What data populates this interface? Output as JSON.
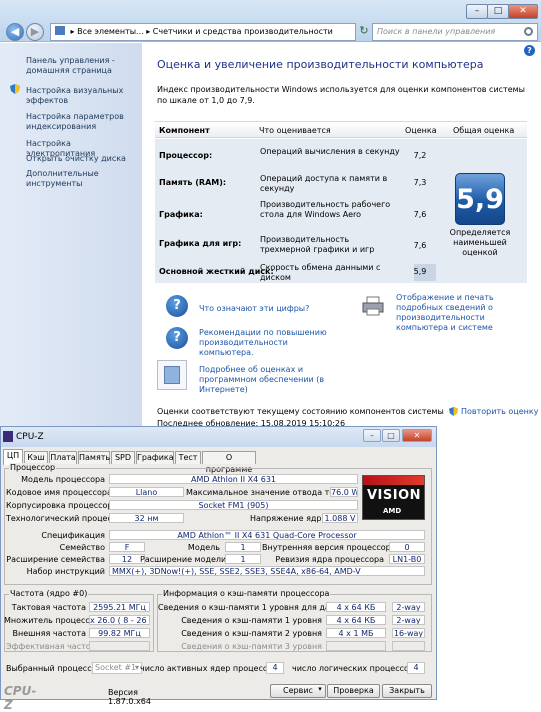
{
  "control_panel": {
    "breadcrumb": [
      "Все элементы...",
      "Счетчики и средства производительности"
    ],
    "search_placeholder": "Поиск в панели управления",
    "sidebar": {
      "items": [
        {
          "label": "Панель управления -\nдомашняя страница",
          "icon": ""
        },
        {
          "label": "Настройка визуальных\nэффектов",
          "icon": "shield-icon"
        },
        {
          "label": "Настройка параметров\nиндексирования",
          "icon": ""
        },
        {
          "label": "Настройка электропитания",
          "icon": ""
        },
        {
          "label": "Открыть очистку диска",
          "icon": ""
        },
        {
          "label": "Дополнительные\nинструменты",
          "icon": ""
        }
      ]
    },
    "title": "Оценка и увеличение производительности компьютера",
    "description": "Индекс производительности Windows используется для оценки компонентов системы по шкале от 1,0 до 7,9.",
    "table": {
      "headers": [
        "Компонент",
        "Что оценивается",
        "Оценка",
        "Общая оценка"
      ],
      "rows": [
        {
          "component": "Процессор:",
          "what": "Операций вычисления в секунду",
          "score": "7,2"
        },
        {
          "component": "Память (RAM):",
          "what": "Операций доступа к памяти в секунду",
          "score": "7,3"
        },
        {
          "component": "Графика:",
          "what": "Производительность рабочего стола для Windows Aero",
          "score": "7,6"
        },
        {
          "component": "Графика для игр:",
          "what": "Производительность трехмерной графики и игр",
          "score": "7,6"
        },
        {
          "component": "Основной жесткий диск:",
          "what": "Скорость обмена данными с диском",
          "score": "5,9"
        }
      ],
      "base_score": "5,9",
      "base_caption": "Определяется наименьшей оценкой"
    },
    "links": {
      "what_numbers": "Что означают эти цифры?",
      "print": "Отображение и печать подробных сведений о производительности компьютера и системе",
      "tips": "Рекомендации по повышению производительности компьютера.",
      "learn_more": "Подробнее об оценках и программном обеспечении (в Интернете)"
    },
    "footer": {
      "current": "Оценки соответствуют текущему состоянию компонентов системы",
      "last_update": "Последнее обновление: 15.08.2019 15:10:26",
      "rerun": "Повторить оценку"
    }
  },
  "cpuz": {
    "title": "CPU-Z",
    "tabs": [
      "ЦП",
      "Кэш",
      "Плата",
      "Память",
      "SPD",
      "Графика",
      "Тест",
      "О программе"
    ],
    "processor_group": "Процессор",
    "labels": {
      "model": "Модель процессора",
      "codename": "Кодовое имя процессора",
      "tdp": "Максимальное значение отвода тепла",
      "package": "Корпусировка процессора",
      "technology": "Технологический процесс",
      "voltage": "Напряжение ядра",
      "spec": "Спецификация",
      "family": "Семейство",
      "model_num": "Модель",
      "stepping": "Внутренняя версия процессора",
      "ext_family": "Расширение семейства",
      "ext_model": "Расширение модели",
      "revision": "Ревизия ядра процессора",
      "instructions": "Набор инструкций"
    },
    "values": {
      "model": "AMD Athlon II X4 631",
      "codename": "Llano",
      "tdp": "76.0 W",
      "package": "Socket FM1 (905)",
      "technology": "32 нм",
      "voltage": "1.088 V",
      "spec": "AMD Athlon™ II X4 631 Quad-Core Processor",
      "family": "F",
      "model_num": "1",
      "stepping": "0",
      "ext_family": "12",
      "ext_model": "1",
      "revision": "LN1-B0",
      "instructions": "MMX(+), 3DNow!(+), SSE, SSE2, SSE3, SSE4A, x86-64, AMD-V"
    },
    "logo": {
      "brand": "VISION",
      "sub": "AMD"
    },
    "clocks_group": "Частота (ядро #0)",
    "clocks": {
      "core_label": "Тактовая частота",
      "core": "2595.21 МГц",
      "mult_label": "Множитель процессора",
      "mult": "x 26.0 ( 8 - 26 )",
      "bus_label": "Внешняя частота",
      "bus": "99.82 МГц",
      "fsb_label": "Эффективная частота",
      "fsb": ""
    },
    "cache_group": "Информация о кэш-памяти процессора",
    "cache": [
      {
        "label": "Сведения о кэш-памяти 1 уровня для данных",
        "size": "4 x 64 КБ",
        "way": "2-way"
      },
      {
        "label": "Сведения о кэш-памяти 1 уровня",
        "size": "4 x 64 КБ",
        "way": "2-way"
      },
      {
        "label": "Сведения о кэш-памяти 2 уровня",
        "size": "4 x 1 МБ",
        "way": "16-way"
      },
      {
        "label": "Сведения о кэш-памяти 3 уровня",
        "size": "",
        "way": ""
      }
    ],
    "bottom": {
      "selected_label": "Выбранный процессор:",
      "selected_value": "Socket #1",
      "cores_label": "число активных ядер процессора",
      "cores": "4",
      "threads_label": "число логических процессоров",
      "threads": "4"
    },
    "footer": {
      "brand": "CPU-Z",
      "version": "Версия 1.87.0.x64",
      "tools": "Сервис",
      "validate": "Проверка",
      "close": "Закрыть"
    }
  }
}
